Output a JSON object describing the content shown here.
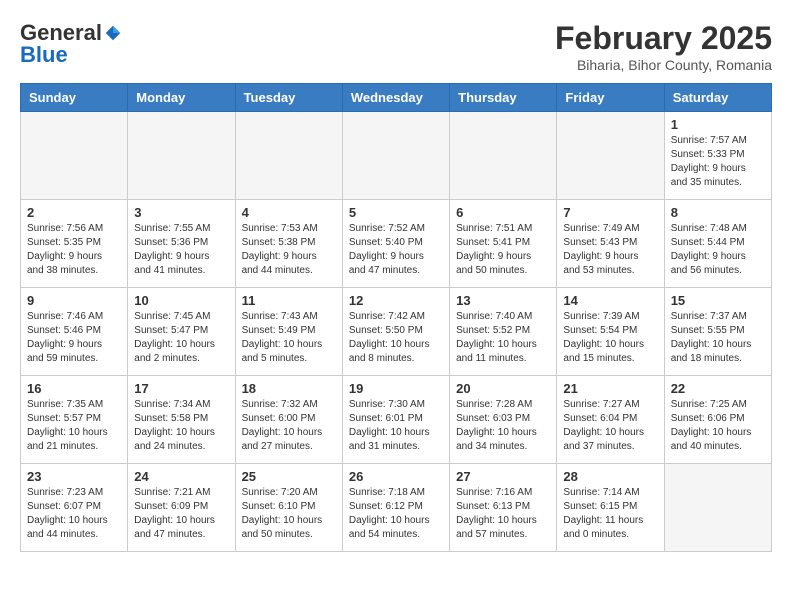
{
  "logo": {
    "general": "General",
    "blue": "Blue"
  },
  "header": {
    "month": "February 2025",
    "location": "Biharia, Bihor County, Romania"
  },
  "days_of_week": [
    "Sunday",
    "Monday",
    "Tuesday",
    "Wednesday",
    "Thursday",
    "Friday",
    "Saturday"
  ],
  "weeks": [
    [
      {
        "day": "",
        "info": ""
      },
      {
        "day": "",
        "info": ""
      },
      {
        "day": "",
        "info": ""
      },
      {
        "day": "",
        "info": ""
      },
      {
        "day": "",
        "info": ""
      },
      {
        "day": "",
        "info": ""
      },
      {
        "day": "1",
        "info": "Sunrise: 7:57 AM\nSunset: 5:33 PM\nDaylight: 9 hours and 35 minutes."
      }
    ],
    [
      {
        "day": "2",
        "info": "Sunrise: 7:56 AM\nSunset: 5:35 PM\nDaylight: 9 hours and 38 minutes."
      },
      {
        "day": "3",
        "info": "Sunrise: 7:55 AM\nSunset: 5:36 PM\nDaylight: 9 hours and 41 minutes."
      },
      {
        "day": "4",
        "info": "Sunrise: 7:53 AM\nSunset: 5:38 PM\nDaylight: 9 hours and 44 minutes."
      },
      {
        "day": "5",
        "info": "Sunrise: 7:52 AM\nSunset: 5:40 PM\nDaylight: 9 hours and 47 minutes."
      },
      {
        "day": "6",
        "info": "Sunrise: 7:51 AM\nSunset: 5:41 PM\nDaylight: 9 hours and 50 minutes."
      },
      {
        "day": "7",
        "info": "Sunrise: 7:49 AM\nSunset: 5:43 PM\nDaylight: 9 hours and 53 minutes."
      },
      {
        "day": "8",
        "info": "Sunrise: 7:48 AM\nSunset: 5:44 PM\nDaylight: 9 hours and 56 minutes."
      }
    ],
    [
      {
        "day": "9",
        "info": "Sunrise: 7:46 AM\nSunset: 5:46 PM\nDaylight: 9 hours and 59 minutes."
      },
      {
        "day": "10",
        "info": "Sunrise: 7:45 AM\nSunset: 5:47 PM\nDaylight: 10 hours and 2 minutes."
      },
      {
        "day": "11",
        "info": "Sunrise: 7:43 AM\nSunset: 5:49 PM\nDaylight: 10 hours and 5 minutes."
      },
      {
        "day": "12",
        "info": "Sunrise: 7:42 AM\nSunset: 5:50 PM\nDaylight: 10 hours and 8 minutes."
      },
      {
        "day": "13",
        "info": "Sunrise: 7:40 AM\nSunset: 5:52 PM\nDaylight: 10 hours and 11 minutes."
      },
      {
        "day": "14",
        "info": "Sunrise: 7:39 AM\nSunset: 5:54 PM\nDaylight: 10 hours and 15 minutes."
      },
      {
        "day": "15",
        "info": "Sunrise: 7:37 AM\nSunset: 5:55 PM\nDaylight: 10 hours and 18 minutes."
      }
    ],
    [
      {
        "day": "16",
        "info": "Sunrise: 7:35 AM\nSunset: 5:57 PM\nDaylight: 10 hours and 21 minutes."
      },
      {
        "day": "17",
        "info": "Sunrise: 7:34 AM\nSunset: 5:58 PM\nDaylight: 10 hours and 24 minutes."
      },
      {
        "day": "18",
        "info": "Sunrise: 7:32 AM\nSunset: 6:00 PM\nDaylight: 10 hours and 27 minutes."
      },
      {
        "day": "19",
        "info": "Sunrise: 7:30 AM\nSunset: 6:01 PM\nDaylight: 10 hours and 31 minutes."
      },
      {
        "day": "20",
        "info": "Sunrise: 7:28 AM\nSunset: 6:03 PM\nDaylight: 10 hours and 34 minutes."
      },
      {
        "day": "21",
        "info": "Sunrise: 7:27 AM\nSunset: 6:04 PM\nDaylight: 10 hours and 37 minutes."
      },
      {
        "day": "22",
        "info": "Sunrise: 7:25 AM\nSunset: 6:06 PM\nDaylight: 10 hours and 40 minutes."
      }
    ],
    [
      {
        "day": "23",
        "info": "Sunrise: 7:23 AM\nSunset: 6:07 PM\nDaylight: 10 hours and 44 minutes."
      },
      {
        "day": "24",
        "info": "Sunrise: 7:21 AM\nSunset: 6:09 PM\nDaylight: 10 hours and 47 minutes."
      },
      {
        "day": "25",
        "info": "Sunrise: 7:20 AM\nSunset: 6:10 PM\nDaylight: 10 hours and 50 minutes."
      },
      {
        "day": "26",
        "info": "Sunrise: 7:18 AM\nSunset: 6:12 PM\nDaylight: 10 hours and 54 minutes."
      },
      {
        "day": "27",
        "info": "Sunrise: 7:16 AM\nSunset: 6:13 PM\nDaylight: 10 hours and 57 minutes."
      },
      {
        "day": "28",
        "info": "Sunrise: 7:14 AM\nSunset: 6:15 PM\nDaylight: 11 hours and 0 minutes."
      },
      {
        "day": "",
        "info": ""
      }
    ]
  ]
}
